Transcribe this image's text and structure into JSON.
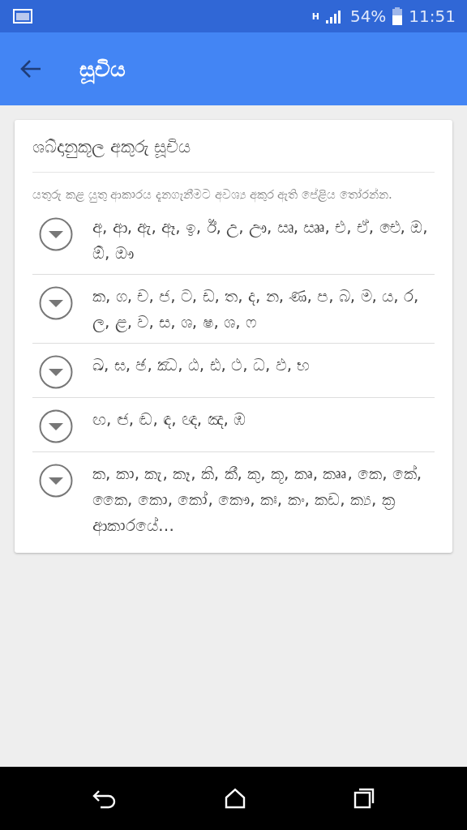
{
  "status_bar": {
    "battery": "54%",
    "time": "11:51",
    "network": "H"
  },
  "app_bar": {
    "title": "සූචිය"
  },
  "card": {
    "title": "ශබ්දානුකූල අකුරු සූචිය",
    "description": "යතුරු කළ යුතු ආකාරය දැනගැනීමට අවශ්‍ය අකුර ඇති පේළිය තෝරන්න.",
    "rows": [
      {
        "letters": "අ, ආ, ඇ, ඈ, ඉ, ඊ, උ, ඌ, ඍ, ඎ, එ, ඒ, ඓ, ඔ, ඕ, ඖ",
        "expanded": false
      },
      {
        "letters": "ක, ග, ච, ජ, ට, ඩ, ත, ද, න, ණ, ප, බ, ම, ය, ර, ල, ළ, ව, ස, ශ, ෂ, ශ, ෆ",
        "expanded": false
      },
      {
        "letters": "ඛ, ඝ, ඡ, ඣ, ඨ, ඪ, ථ, ධ, ඵ, භ",
        "expanded": false
      },
      {
        "letters": "ඟ, ඦ, ඬ, ඳ, ඥ, ඤ, ඹ",
        "expanded": false
      },
      {
        "letters": "ක, කා, කැ, කෑ, කි, කී, කු, කූ, කෘ, කෲ, කෙ, කේ, කෛ, කො, කෝ, කෞ, කඃ, කං, කඩ, ක්‍ය, ක්‍ර ආකාරයේ…",
        "expanded": false
      }
    ]
  }
}
